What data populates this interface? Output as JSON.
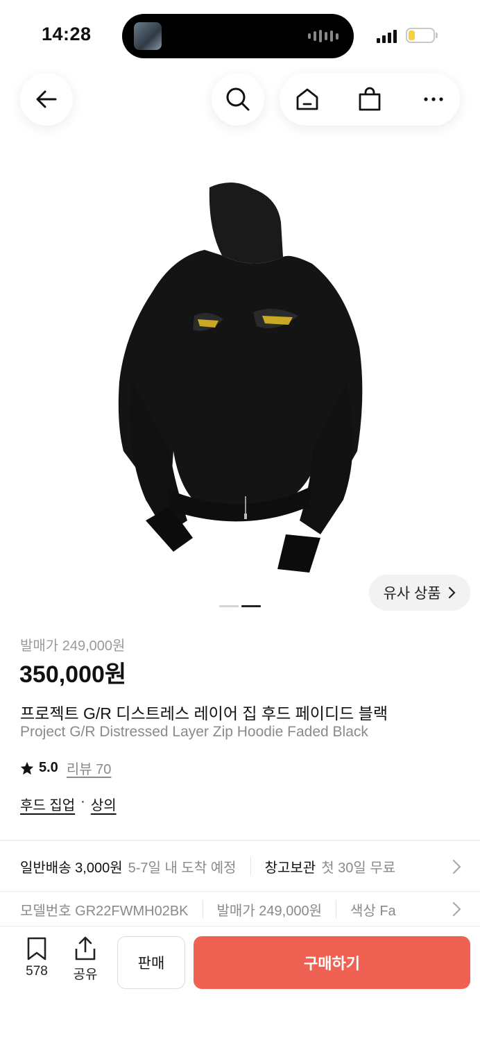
{
  "status_bar": {
    "time": "14:28"
  },
  "nav": {
    "icons": [
      "back-arrow-icon",
      "search-icon",
      "home-icon",
      "shopping-bag-icon",
      "more-icon"
    ]
  },
  "gallery": {
    "image_alt": "black distressed zip hoodie",
    "similar_label": "유사 상품",
    "page_count": 2,
    "active_page": 2
  },
  "product": {
    "release_price": "발매가 249,000원",
    "price": "350,000원",
    "title_ko": "프로젝트 G/R 디스트레스 레이어 집 후드 페이디드 블랙",
    "title_en": "Project G/R Distressed Layer Zip Hoodie Faded Black",
    "rating": "5.0",
    "review_label": "리뷰 70",
    "category_1": "후드 집업",
    "category_sep": "·",
    "category_2": "상의"
  },
  "delivery": {
    "standard_label": "일반배송 3,000원",
    "standard_eta": "5-7일 내 도착 예정",
    "storage_label": "창고보관",
    "storage_promo": "첫 30일 무료"
  },
  "specs": {
    "model": "모델번호 GR22FWMH02BK",
    "release": "발매가 249,000원",
    "color": "색상 Fa"
  },
  "bottom_bar": {
    "wishlist_count": "578",
    "share_label": "공유",
    "sell_label": "판매",
    "buy_label": "구매하기"
  },
  "colors": {
    "accent": "#ef6253",
    "muted_text": "#8a8a8a"
  }
}
